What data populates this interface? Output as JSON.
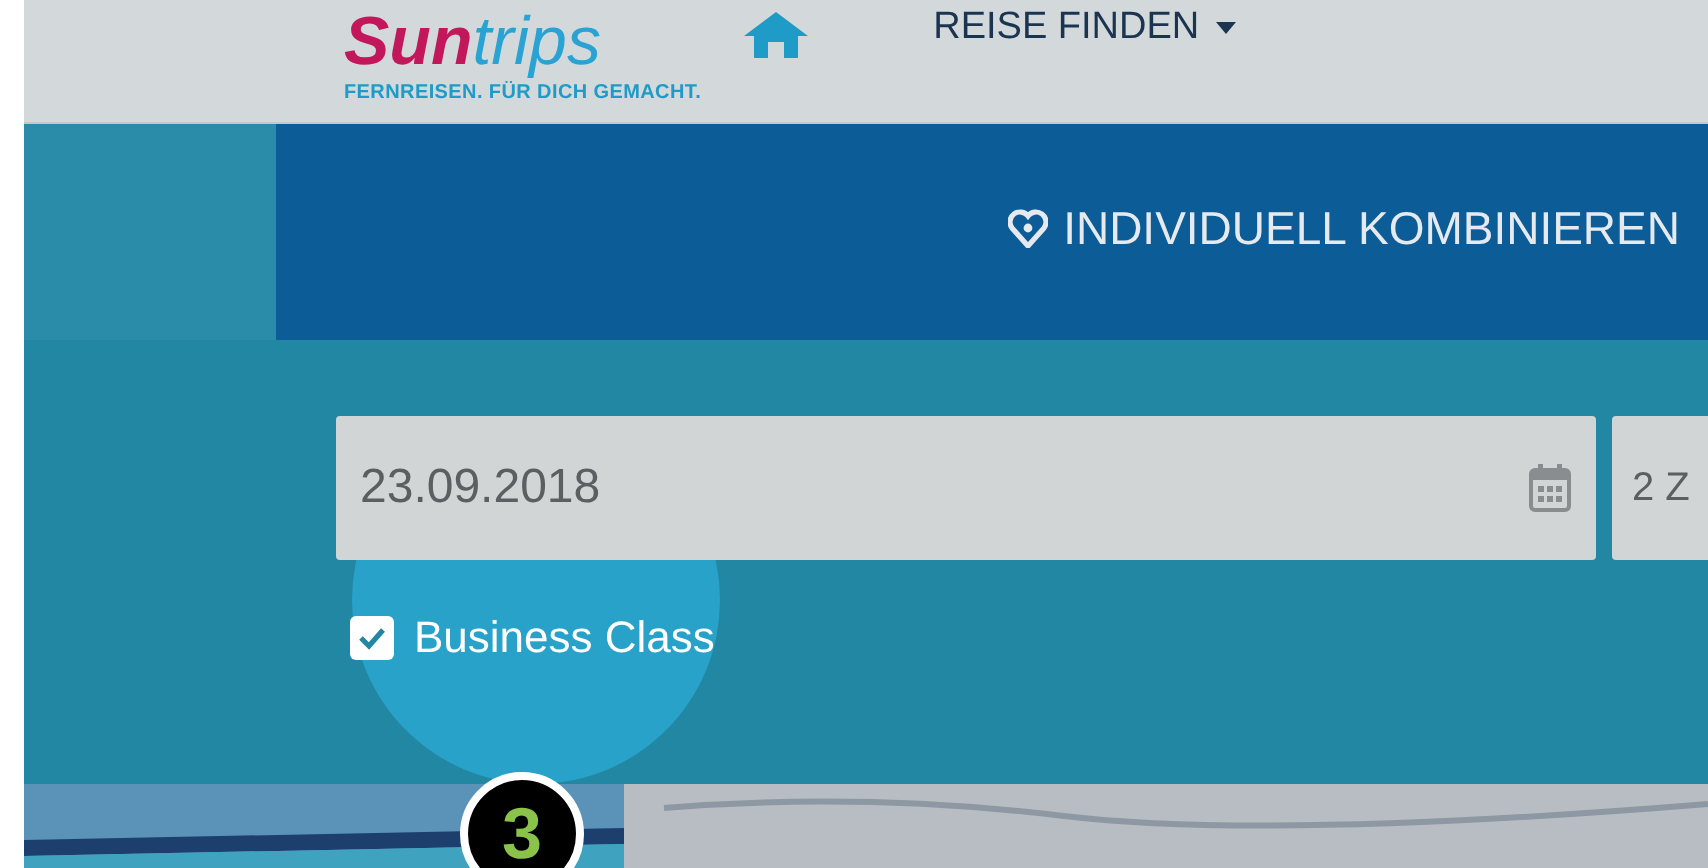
{
  "header": {
    "logo": {
      "part_1": "Sun",
      "part_2": "trips",
      "tagline": "FERNREISEN. FÜR DICH GEMACHT."
    },
    "menu": "REISE FINDEN"
  },
  "nav": {
    "label": "INDIVIDUELL KOMBINIEREN"
  },
  "search": {
    "date_field": {
      "value": "23.09.2018"
    },
    "rooms_field": {
      "value": "2 Z"
    },
    "options": [
      {
        "label": "Business Class",
        "checked": true
      }
    ]
  },
  "step_badge": {
    "number": "3"
  }
}
